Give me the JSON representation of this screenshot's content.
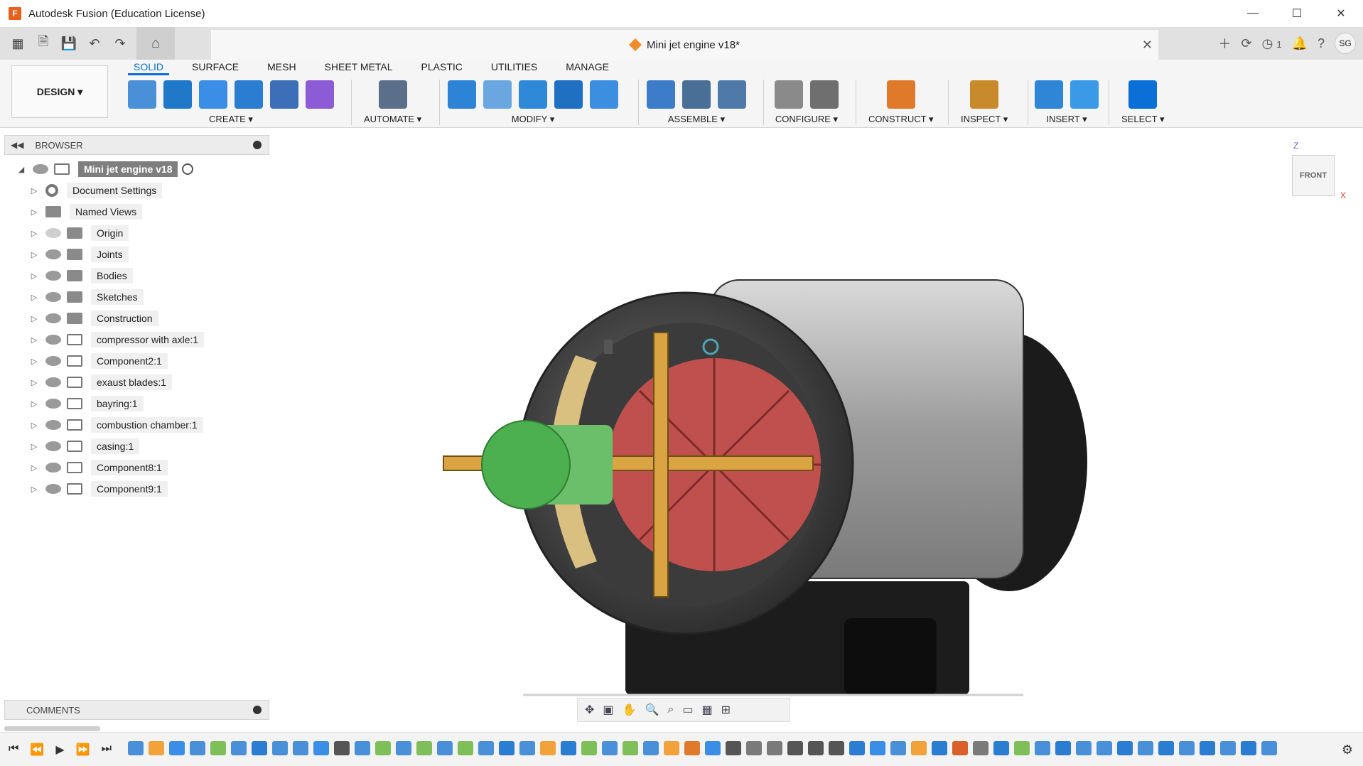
{
  "window": {
    "title": "Autodesk Fusion (Education License)",
    "minimize": "—",
    "maximize": "☐",
    "close": "✕"
  },
  "document": {
    "tab_title": "Mini jet engine v18*",
    "notification_count": "1",
    "user_initials": "SG"
  },
  "workspace": {
    "label": "DESIGN ▾"
  },
  "ribbon_tabs": [
    "SOLID",
    "SURFACE",
    "MESH",
    "SHEET METAL",
    "PLASTIC",
    "UTILITIES",
    "MANAGE"
  ],
  "active_tab": "SOLID",
  "ribbon_groups": [
    {
      "label": "CREATE ▾",
      "icon_colors": [
        "#4a90d9",
        "#1f78c8",
        "#3a8ee6",
        "#2a7dd1",
        "#3d6fb8",
        "#8b5cd6"
      ]
    },
    {
      "label": "AUTOMATE ▾",
      "icon_colors": [
        "#5b6f8a"
      ]
    },
    {
      "label": "MODIFY ▾",
      "icon_colors": [
        "#2d84d6",
        "#6aa7e0",
        "#2e8ad8",
        "#1f6fc2",
        "#3c8ee0"
      ]
    },
    {
      "label": "ASSEMBLE ▾",
      "icon_colors": [
        "#3d7cc9",
        "#4a6f96",
        "#4e79a8"
      ]
    },
    {
      "label": "CONFIGURE ▾",
      "icon_colors": [
        "#8a8a8a",
        "#6f6f6f"
      ]
    },
    {
      "label": "CONSTRUCT ▾",
      "icon_colors": [
        "#e07a2b"
      ]
    },
    {
      "label": "INSPECT ▾",
      "icon_colors": [
        "#c98a2b"
      ]
    },
    {
      "label": "INSERT ▾",
      "icon_colors": [
        "#2f86d6",
        "#3a9ae8"
      ]
    },
    {
      "label": "SELECT ▾",
      "icon_colors": [
        "#0a6fd6"
      ]
    }
  ],
  "browser": {
    "title": "BROWSER",
    "root": "Mini jet engine v18",
    "items": [
      {
        "label": "Document Settings",
        "kind": "gear"
      },
      {
        "label": "Named Views",
        "kind": "folder"
      },
      {
        "label": "Origin",
        "kind": "folder",
        "eye": "hidden"
      },
      {
        "label": "Joints",
        "kind": "folder"
      },
      {
        "label": "Bodies",
        "kind": "folder"
      },
      {
        "label": "Sketches",
        "kind": "folder"
      },
      {
        "label": "Construction",
        "kind": "folder"
      },
      {
        "label": "compressor with axle:1",
        "kind": "component"
      },
      {
        "label": "Component2:1",
        "kind": "component"
      },
      {
        "label": "exaust blades:1",
        "kind": "component"
      },
      {
        "label": "bayring:1",
        "kind": "component"
      },
      {
        "label": "combustion chamber:1",
        "kind": "component"
      },
      {
        "label": "casing:1",
        "kind": "component"
      },
      {
        "label": "Component8:1",
        "kind": "component"
      },
      {
        "label": "Component9:1",
        "kind": "component"
      }
    ]
  },
  "comments": {
    "title": "COMMENTS"
  },
  "viewcube": {
    "face": "FRONT",
    "axis_z": "Z",
    "axis_x": "X"
  },
  "timeline": {
    "controls": [
      "⏮",
      "⏪",
      "▶",
      "⏩",
      "⏭"
    ],
    "item_colors": [
      "#4a90d9",
      "#f2a23a",
      "#3a8ee6",
      "#4a90d9",
      "#7fbf5a",
      "#4a90d9",
      "#2a7dd1",
      "#4a90d9",
      "#4a90d9",
      "#3a8ee6",
      "#555",
      "#4a90d9",
      "#7fbf5a",
      "#4a90d9",
      "#7fbf5a",
      "#4a90d9",
      "#7fbf5a",
      "#4a90d9",
      "#2a7dd1",
      "#4a90d9",
      "#f2a23a",
      "#2a7dd1",
      "#7fbf5a",
      "#4a90d9",
      "#7fbf5a",
      "#4a90d9",
      "#f2a23a",
      "#e07a2b",
      "#3a8ee6",
      "#555",
      "#7a7a7a",
      "#7a7a7a",
      "#555",
      "#555",
      "#555",
      "#2a7dd1",
      "#3a8ee6",
      "#4a90d9",
      "#f2a23a",
      "#2a7dd1",
      "#d9602a",
      "#7a7a7a",
      "#2a7dd1",
      "#7fbf5a",
      "#4a90d9",
      "#2a7dd1",
      "#4a90d9",
      "#4a90d9",
      "#2a7dd1",
      "#4a90d9",
      "#2a7dd1",
      "#4a90d9",
      "#2a7dd1",
      "#4a90d9",
      "#2a7dd1",
      "#4a90d9"
    ]
  },
  "model": {
    "casing_color": "#8a8a8a",
    "rotor_color": "#c0504d",
    "spinner_color": "#4caf50",
    "strut_color": "#d9a441",
    "stand_color": "#1c1c1c"
  }
}
